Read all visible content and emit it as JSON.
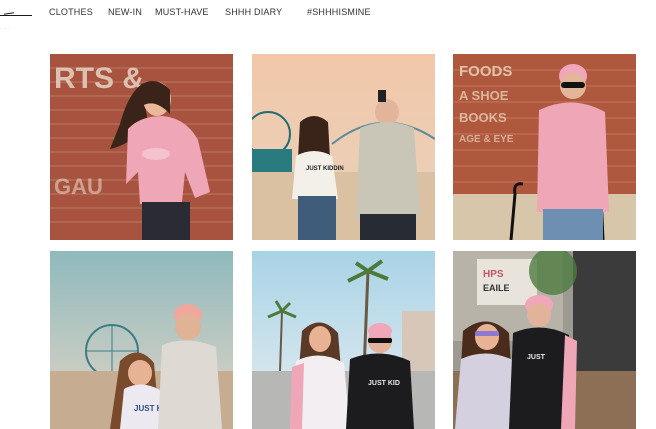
{
  "nav": {
    "items": [
      {
        "label": "CLOTHES"
      },
      {
        "label": "NEW-IN"
      },
      {
        "label": "MUST-HAVE"
      },
      {
        "label": "SHHH DIARY"
      },
      {
        "label": "#SHHHISMINE"
      }
    ]
  },
  "tiles": [
    {
      "shirt_text": "",
      "wall_text": "RTS &"
    },
    {
      "shirt_text": "JUST KIDDIN"
    },
    {
      "shirt_text": "",
      "wall_text": "FOODS"
    },
    {
      "shirt_text": "JUST KIDD"
    },
    {
      "shirt_text": "JUST KID"
    },
    {
      "shirt_text": "JUST"
    }
  ],
  "colors": {
    "brick": "#a7533f",
    "hoodie_pink": "#efa6b7",
    "sky": "#cfdde0"
  }
}
